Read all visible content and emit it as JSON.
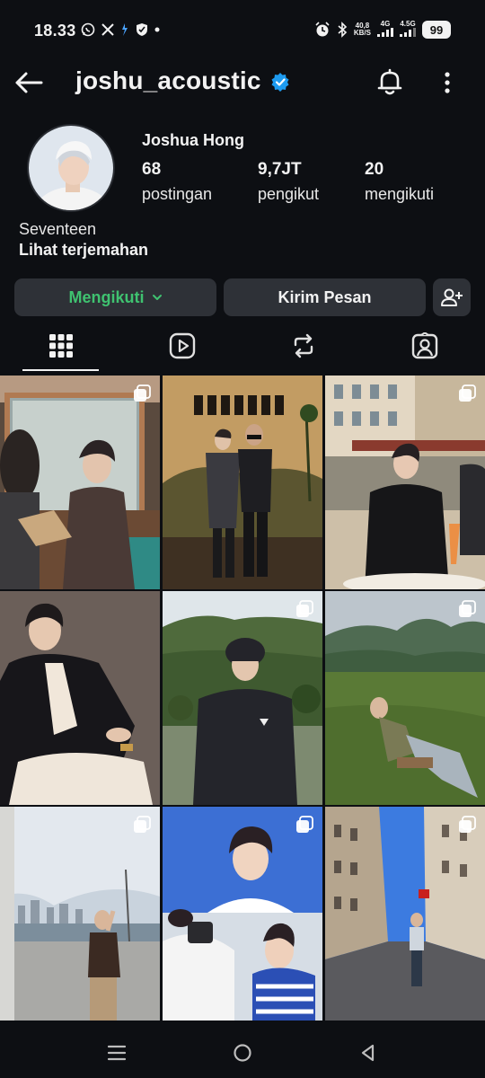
{
  "status_bar": {
    "time": "18.33",
    "net_speed_top": "40,8",
    "net_speed_unit": "KB/S",
    "signal1": "4G",
    "signal2": "4.5G",
    "battery": "99"
  },
  "header": {
    "username": "joshu_acoustic"
  },
  "profile": {
    "full_name": "Joshua Hong",
    "stats": [
      {
        "value": "68",
        "label": "postingan"
      },
      {
        "value": "9,7JT",
        "label": "pengikut"
      },
      {
        "value": "20",
        "label": "mengikuti"
      }
    ],
    "bio": "Seventeen",
    "translate_link": "Lihat terjemahan"
  },
  "actions": {
    "following_label": "Mengikuti",
    "message_label": "Kirim Pesan"
  },
  "tabs": [
    "grid",
    "reels",
    "reposts",
    "tagged"
  ],
  "posts": [
    {
      "scene": "mirror-portrait",
      "multi": true
    },
    {
      "scene": "amiri-event",
      "multi": false
    },
    {
      "scene": "cafe-terrace",
      "multi": true
    },
    {
      "scene": "white-suit",
      "multi": false
    },
    {
      "scene": "mountain-lake",
      "multi": true
    },
    {
      "scene": "meadow-chair",
      "multi": true
    },
    {
      "scene": "harbor-selfie",
      "multi": true
    },
    {
      "scene": "studio-shoot",
      "multi": true
    },
    {
      "scene": "old-town-street",
      "multi": true
    }
  ],
  "colors": {
    "background": "#0d0f13",
    "button_bg": "#2e3137",
    "following_green": "#3fc270",
    "verified_blue": "#1d9bf0"
  }
}
